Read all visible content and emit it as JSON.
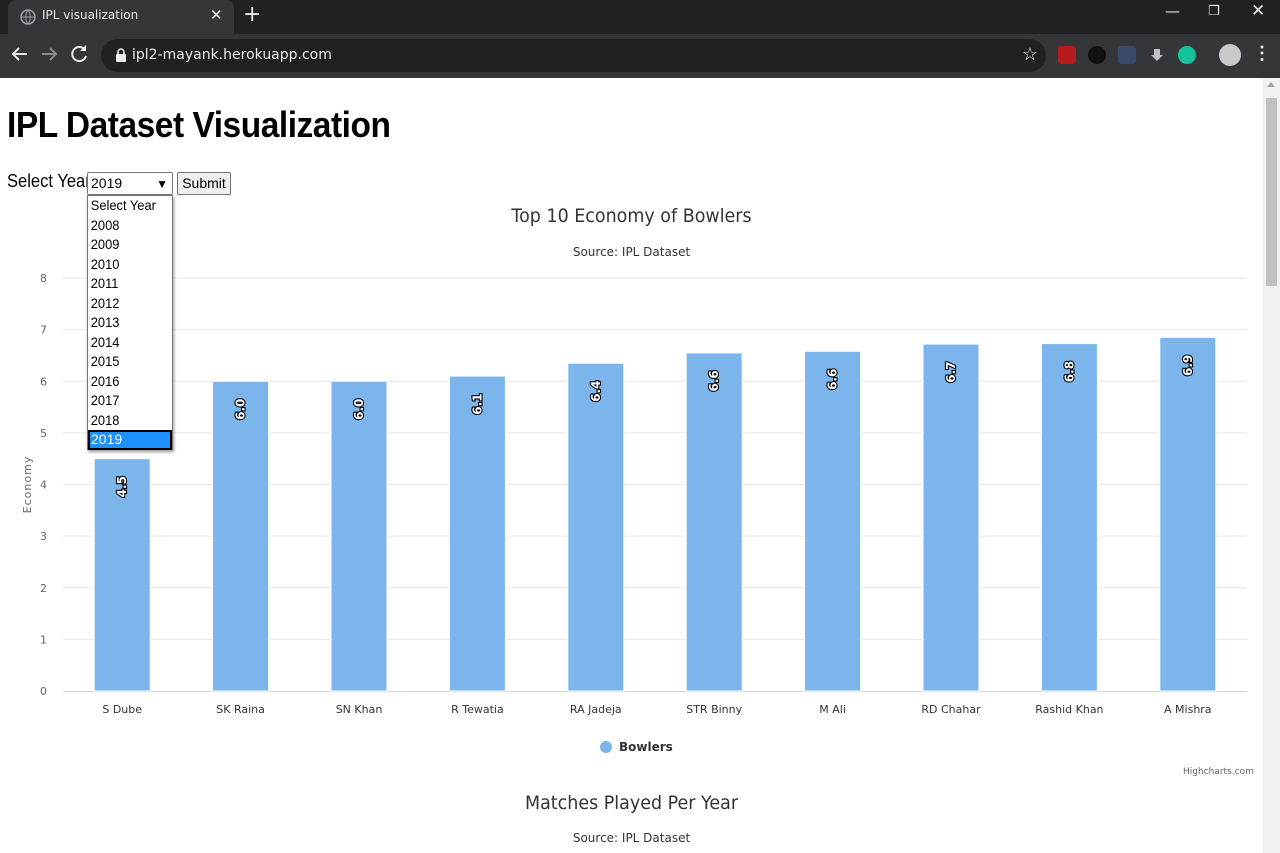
{
  "browser": {
    "tab_title": "IPL visualization",
    "url": "ipl2-mayank.herokuapp.com"
  },
  "page": {
    "title": "IPL Dataset Visualization",
    "year_label": "Select Year",
    "selected_year": "2019",
    "submit_label": "Submit",
    "year_options": [
      "Select Year",
      "2008",
      "2009",
      "2010",
      "2011",
      "2012",
      "2013",
      "2014",
      "2015",
      "2016",
      "2017",
      "2018",
      "2019"
    ]
  },
  "chart_data": [
    {
      "type": "bar",
      "title": "Top 10 Economy of Bowlers",
      "subtitle": "Source: IPL Dataset",
      "ylabel": "Economy",
      "categories": [
        "S Dube",
        "SK Raina",
        "SN Khan",
        "R Tewatia",
        "RA Jadeja",
        "STR Binny",
        "M Ali",
        "RD Chahar",
        "Rashid Khan",
        "A Mishra"
      ],
      "series": [
        {
          "name": "Bowlers",
          "values": [
            4.5,
            6.0,
            6.0,
            6.1,
            6.35,
            6.55,
            6.58,
            6.72,
            6.73,
            6.85
          ],
          "labels": [
            "4.5",
            "6.0",
            "6.0",
            "6.1",
            "6.4",
            "6.6",
            "6.6",
            "6.7",
            "6.8",
            "6.9"
          ],
          "color": "#7cb5ec"
        }
      ],
      "ylim": [
        0,
        8
      ],
      "yticks": [
        "0",
        "1",
        "2",
        "3",
        "4",
        "5",
        "6",
        "7",
        "8"
      ],
      "grid": true,
      "legend": "bottom-center",
      "credit": "Highcharts.com"
    },
    {
      "type": "bar",
      "title": "Matches Played Per Year",
      "subtitle": "Source: IPL Dataset"
    }
  ]
}
